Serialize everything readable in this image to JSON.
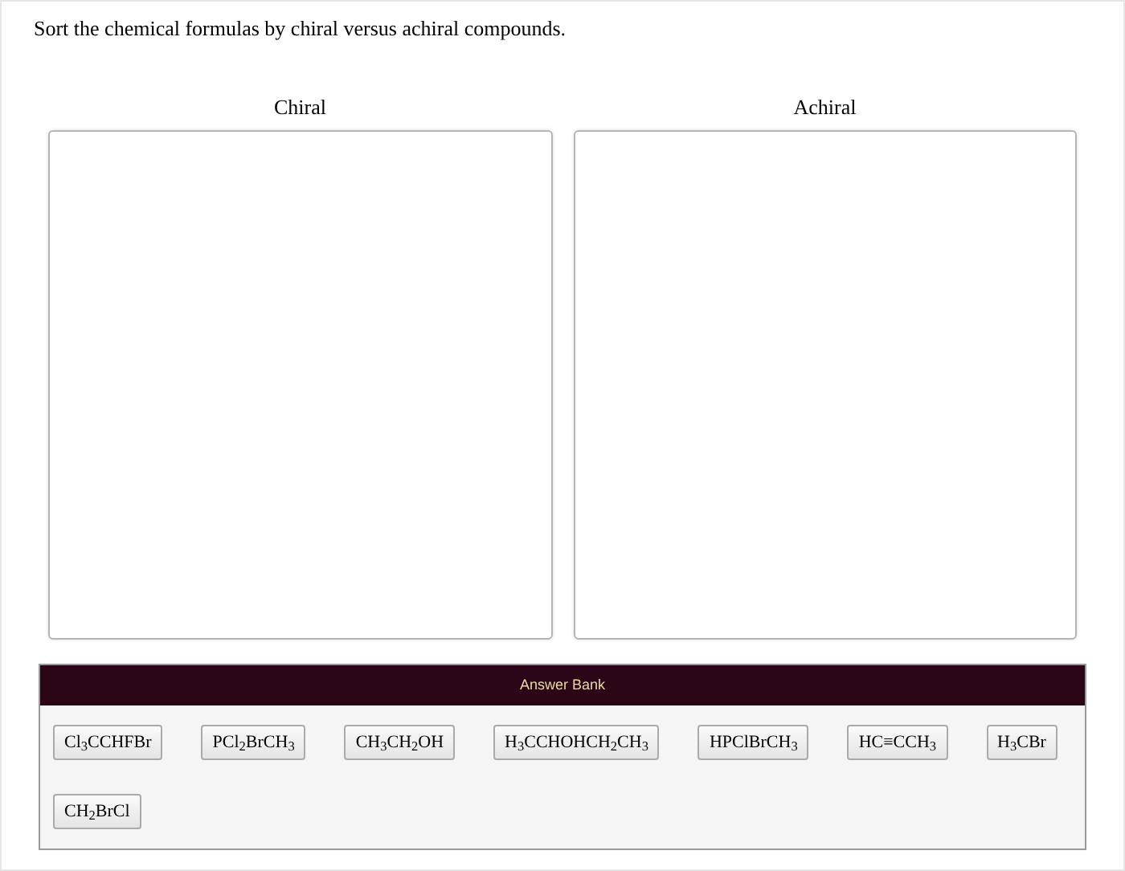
{
  "instruction": "Sort the chemical formulas by chiral versus achiral compounds.",
  "bins": [
    {
      "label": "Chiral"
    },
    {
      "label": "Achiral"
    }
  ],
  "answer_bank": {
    "title": "Answer Bank",
    "items": [
      "Cl$_{3}$CCHFBr",
      "PCl$_{2}$BrCH$_{3}$",
      "CH$_{3}$CH$_{2}$OH",
      "H$_{3}$CCHOHCH$_{2}$CH$_{3}$",
      "HPClBrCH$_{3}$",
      "HC≡CCH$_{3}$",
      "H$_{3}$CBr",
      "CH$_{2}$BrCl"
    ]
  }
}
